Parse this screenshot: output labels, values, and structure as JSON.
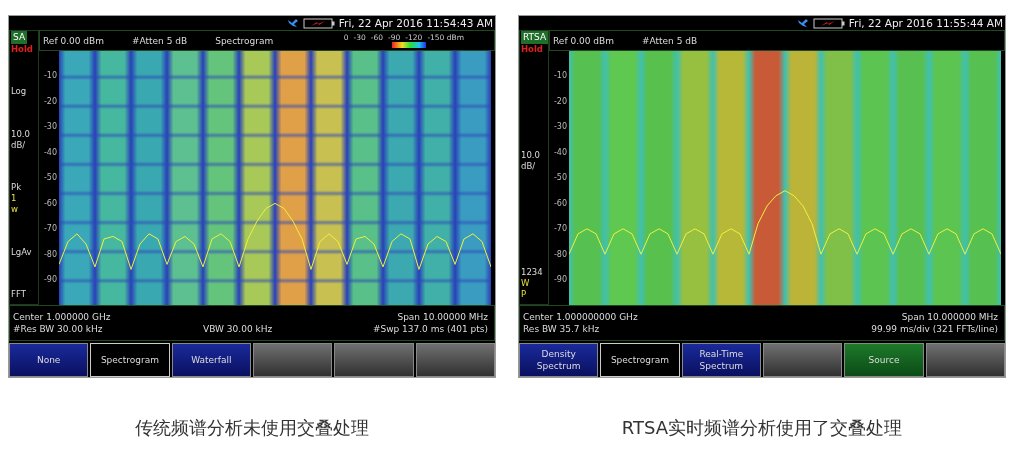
{
  "panels": [
    {
      "mode": "SA",
      "status": "Hold",
      "datetime": "Fri, 22 Apr 2016 11:54:43 AM",
      "header": [
        "Ref 0.00 dBm",
        "#Atten 5 dB",
        "Spectrogram"
      ],
      "color_scale": [
        "0",
        "-30",
        "-60",
        "-90",
        "-120",
        "-150 dBm"
      ],
      "side_groups": [
        [
          {
            "text": "Log",
            "kind": "normal"
          }
        ],
        [
          {
            "text": "10.0",
            "kind": "normal"
          },
          {
            "text": "dB/",
            "kind": "normal"
          }
        ],
        [
          {
            "text": "Pk",
            "kind": "normal"
          },
          {
            "text": "1",
            "kind": "highlight"
          },
          {
            "text": "w",
            "kind": "highlight"
          }
        ],
        [
          {
            "text": "LgAv",
            "kind": "normal"
          }
        ],
        [
          {
            "text": "FFT",
            "kind": "normal"
          }
        ]
      ],
      "plot": {
        "kind": "swept",
        "chart_data": {
          "type": "line",
          "ylim": [
            -100,
            0
          ],
          "yticks": [
            -10,
            -20,
            -30,
            -40,
            -50,
            -60,
            -70,
            -80,
            -90
          ],
          "series": [
            {
              "color": "#f0f040",
              "values": [
                -84,
                -75,
                -72,
                -76,
                -85,
                -74,
                -73,
                -75,
                -86,
                -76,
                -72,
                -74,
                -84,
                -75,
                -73,
                -76,
                -85,
                -74,
                -72,
                -75,
                -85,
                -74,
                -67,
                -62,
                -60,
                -62,
                -67,
                -74,
                -86,
                -75,
                -72,
                -75,
                -84,
                -74,
                -73,
                -76,
                -85,
                -75,
                -72,
                -74,
                -86,
                -76,
                -73,
                -75,
                -84,
                -74,
                -72,
                -75,
                -85
              ]
            }
          ]
        }
      },
      "info_rows": [
        {
          "left": "Center 1.000000 GHz",
          "right": "Span 10.00000 MHz"
        },
        {
          "left": "#Res BW 30.00 kHz",
          "center": "VBW 30.00 kHz",
          "right": "#Swp 137.0 ms (401 pts)"
        }
      ],
      "softkeys": [
        {
          "label": "None",
          "kind": "option"
        },
        {
          "label": "Spectrogram",
          "kind": "current"
        },
        {
          "label": "Waterfall",
          "kind": "option"
        },
        {
          "kind": "blank"
        },
        {
          "kind": "blank"
        },
        {
          "kind": "blank"
        }
      ],
      "caption": "传统频谱分析未使用交叠处理"
    },
    {
      "mode": "RTSA",
      "status": "Hold",
      "datetime": "Fri, 22 Apr 2016 11:55:44 AM",
      "header": [
        "Ref 0.00 dBm",
        "#Atten 5 dB"
      ],
      "side_groups": [
        [
          {
            "text": "10.0",
            "kind": "normal"
          },
          {
            "text": "dB/",
            "kind": "normal"
          }
        ],
        [
          {
            "text": "1234",
            "kind": "normal"
          },
          {
            "text": "W",
            "kind": "highlight"
          },
          {
            "text": "P",
            "kind": "highlight"
          }
        ]
      ],
      "plot": {
        "kind": "realtime",
        "chart_data": {
          "type": "line",
          "ylim": [
            -100,
            0
          ],
          "yticks": [
            -10,
            -20,
            -30,
            -40,
            -50,
            -60,
            -70,
            -80,
            -90
          ],
          "series": [
            {
              "color": "#f0f040",
              "values": [
                -80,
                -72,
                -70,
                -72,
                -80,
                -72,
                -70,
                -72,
                -80,
                -72,
                -70,
                -72,
                -80,
                -72,
                -70,
                -72,
                -80,
                -72,
                -70,
                -72,
                -80,
                -68,
                -61,
                -57,
                -55,
                -57,
                -61,
                -68,
                -80,
                -72,
                -70,
                -72,
                -80,
                -72,
                -70,
                -72,
                -80,
                -72,
                -70,
                -72,
                -80,
                -72,
                -70,
                -72,
                -80,
                -72,
                -70,
                -72,
                -80
              ]
            }
          ]
        }
      },
      "info_rows": [
        {
          "left": "Center 1.000000000 GHz",
          "right": "Span 10.000000 MHz"
        },
        {
          "left": "Res BW 35.7 kHz",
          "right": "99.99 ms/div (321 FFTs/line)"
        }
      ],
      "softkeys": [
        {
          "label": "Density Spectrum",
          "kind": "option"
        },
        {
          "label": "Spectrogram",
          "kind": "current"
        },
        {
          "label": "Real-Time Spectrum",
          "kind": "option"
        },
        {
          "kind": "blank"
        },
        {
          "label": "Source",
          "kind": "accent"
        },
        {
          "kind": "blank"
        }
      ],
      "caption": "RTSA实时频谱分析使用了交叠处理"
    }
  ]
}
